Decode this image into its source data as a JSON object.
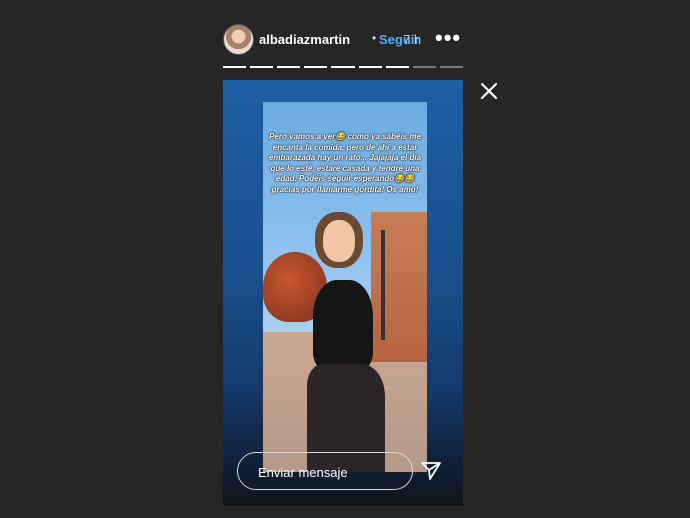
{
  "header": {
    "username": "albadiazmartin",
    "separator": "•",
    "follow_label": "Seguir",
    "time_ago": "7 h",
    "more_label": "•••"
  },
  "progress": {
    "segments_total": 9,
    "segments_viewed": 7
  },
  "story": {
    "caption": "Pero vamos a ver😂 como ya sabéis me encanta la comida, pero de ahí a estar embarazada hay un rato... Jajajaja el día que lo esté, estaré casada y tendré una edad. Podéis seguir esperando😂😂 gracias por llamarme gordita! Os amo!"
  },
  "reply": {
    "placeholder": "Enviar mensaje"
  },
  "icons": {
    "close": "close-icon",
    "send": "paper-plane-icon",
    "more": "more-icon"
  },
  "colors": {
    "background": "#262626",
    "follow": "#4db1ff"
  }
}
